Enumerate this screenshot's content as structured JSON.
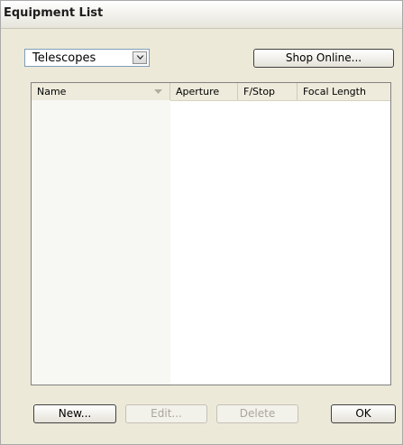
{
  "window": {
    "title": "Equipment List"
  },
  "filter": {
    "selected": "Telescopes"
  },
  "toolbar": {
    "shop_label": "Shop Online..."
  },
  "table": {
    "columns": [
      "Name",
      "Aperture",
      "F/Stop",
      "Focal Length"
    ],
    "rows": []
  },
  "footer": {
    "new_label": "New...",
    "edit_label": "Edit...",
    "delete_label": "Delete",
    "ok_label": "OK"
  }
}
